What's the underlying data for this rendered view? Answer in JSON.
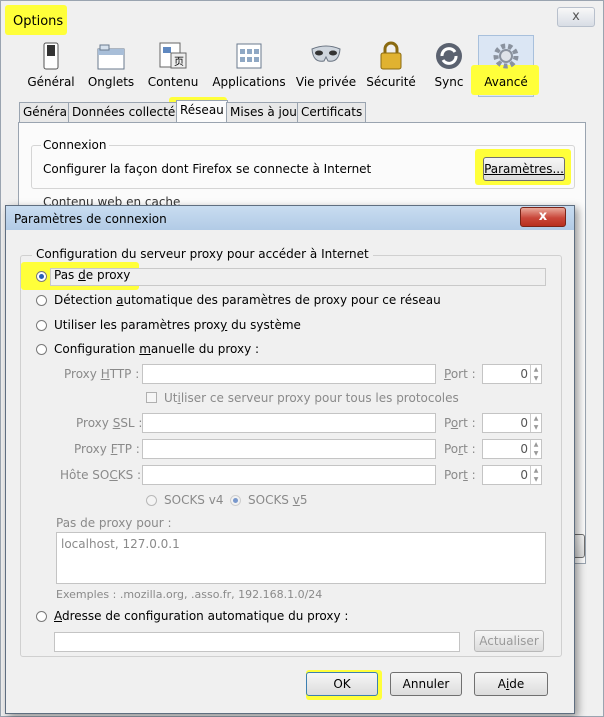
{
  "options_window": {
    "title": "Options",
    "close_label": "x",
    "toolbar": [
      {
        "label": "Général",
        "icon": "general-switch-icon"
      },
      {
        "label": "Onglets",
        "icon": "tabs-window-icon"
      },
      {
        "label": "Contenu",
        "icon": "content-page-icon"
      },
      {
        "label": "Applications",
        "icon": "applications-icon"
      },
      {
        "label": "Vie privée",
        "icon": "privacy-mask-icon"
      },
      {
        "label": "Sécurité",
        "icon": "security-lock-icon"
      },
      {
        "label": "Sync",
        "icon": "sync-icon"
      },
      {
        "label": "Avancé",
        "icon": "advanced-gear-icon"
      }
    ],
    "tabs": [
      "Général",
      "Données collectées",
      "Réseau",
      "Mises à jour",
      "Certificats"
    ],
    "connexion": {
      "legend": "Connexion",
      "description": "Configurer la façon dont Firefox se connecte à Internet",
      "button_label": "Paramètres...",
      "partial_text": "Contenu web en cache"
    }
  },
  "dialog": {
    "title": "Paramètres de connexion",
    "close_label": "x",
    "group_legend": "Configuration du serveur proxy pour accéder à Internet",
    "radios": {
      "none": {
        "pre": "Pas ",
        "u": "d",
        "post": "e proxy"
      },
      "auto": {
        "pre": "Détection ",
        "u": "a",
        "post": "utomatique des paramètres de proxy pour ce réseau"
      },
      "system": {
        "pre": "Utiliser les paramètres prox",
        "u": "y",
        "post": " du système"
      },
      "manual": {
        "pre": "Configuration ",
        "u": "m",
        "post": "anuelle du proxy :"
      },
      "pac": {
        "pre": "",
        "u": "A",
        "post": "dresse de configuration automatique du proxy :"
      }
    },
    "fields": {
      "http": {
        "pre": "Proxy ",
        "u": "H",
        "post": "TTP :"
      },
      "ssl": {
        "pre": "Proxy ",
        "u": "S",
        "post": "SL :"
      },
      "ftp": {
        "pre": "Proxy ",
        "u": "F",
        "post": "TP :"
      },
      "socks": {
        "pre": "Hôte SO",
        "u": "C",
        "post": "KS :"
      },
      "port_http": {
        "pre": "",
        "u": "P",
        "post": "ort :"
      },
      "port_ssl": {
        "pre": "P",
        "u": "o",
        "post": "rt :"
      },
      "port_ftp": {
        "pre": "Po",
        "u": "r",
        "post": "t :"
      },
      "port_socks": {
        "pre": "Por",
        "u": "t",
        "post": " :"
      },
      "port_value": "0"
    },
    "same_proxy": {
      "pre": "Ut",
      "u": "i",
      "post": "liser ce serveur proxy pour tous les protocoles"
    },
    "socks_v4": "SOCKS v4",
    "socks_v5": {
      "pre": "SOCKS ",
      "u": "v",
      "post": "5"
    },
    "no_proxy_for_label": "Pas de proxy pour :",
    "no_proxy_for_value": "localhost, 127.0.0.1",
    "examples": "Exemples : .mozilla.org, .asso.fr, 192.168.1.0/24",
    "reload_label": "Actualiser",
    "ok_label": "OK",
    "cancel_label": "Annuler",
    "help": {
      "pre": "A",
      "u": "i",
      "post": "de"
    }
  },
  "highlight_color": "#ffff3a"
}
